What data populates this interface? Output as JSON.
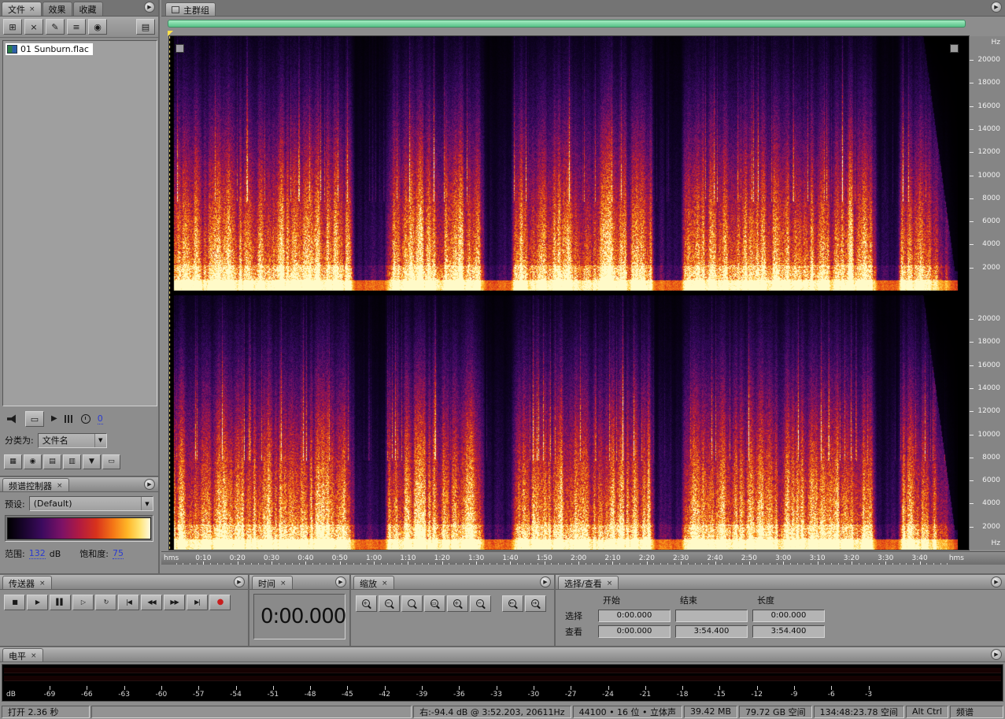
{
  "colors": {
    "accent_green": "#6fcf97",
    "record_red": "#c81e1e",
    "value_blue": "#2a3bd0"
  },
  "ui": {
    "panel_menu_glyph": "▶",
    "dropdown_arrow": "▼"
  },
  "files_panel": {
    "tabs": [
      {
        "label": "文件",
        "close": "×"
      },
      {
        "label": "效果"
      },
      {
        "label": "收藏"
      }
    ],
    "toolbar": [
      {
        "name": "import-file-button",
        "glyph": "⊞"
      },
      {
        "name": "close-file-button",
        "glyph": "×"
      },
      {
        "name": "edit-file-button",
        "glyph": "✎"
      },
      {
        "name": "insert-into-multitrack-button",
        "glyph": "≡"
      },
      {
        "name": "insert-into-cd-button",
        "glyph": "◉"
      }
    ],
    "options_button_glyph": "▤",
    "files": [
      {
        "name": "01 Sunburn.flac"
      }
    ],
    "media_row": {
      "play_glyph": "▶",
      "follow_glyph": "▭",
      "value": "0"
    },
    "sort": {
      "label": "分类为:",
      "value": "文件名"
    },
    "view_toggles": [
      {
        "name": "show-audio-files-toggle",
        "glyph": "▦"
      },
      {
        "name": "show-loop-files-toggle",
        "glyph": "◉"
      },
      {
        "name": "show-video-files-toggle",
        "glyph": "▤"
      },
      {
        "name": "show-session-files-toggle",
        "glyph": "▥"
      },
      {
        "name": "filter-files-toggle",
        "glyph": "▼"
      },
      {
        "name": "show-full-path-toggle",
        "glyph": "▭"
      }
    ]
  },
  "spectral_panel": {
    "title": "频谱控制器",
    "close": "×",
    "preset_label": "预设:",
    "preset_value": "(Default)",
    "range_label": "范围:",
    "range_value": "132",
    "range_unit": "dB",
    "saturation_label": "饱和度:",
    "saturation_value": "75"
  },
  "main": {
    "tab": "主群组",
    "timeline_unit": "hms",
    "time_tick_labels": [
      "0:10",
      "0:20",
      "0:30",
      "0:40",
      "0:50",
      "1:00",
      "1:10",
      "1:20",
      "1:30",
      "1:40",
      "1:50",
      "2:00",
      "2:10",
      "2:20",
      "2:30",
      "2:40",
      "2:50",
      "3:00",
      "3:10",
      "3:20",
      "3:30",
      "3:40"
    ],
    "freq_unit": "Hz",
    "freq_tick_labels": [
      "20000",
      "18000",
      "16000",
      "14000",
      "12000",
      "10000",
      "8000",
      "6000",
      "4000",
      "2000"
    ],
    "view_duration_seconds": 234.4
  },
  "transport": {
    "title": "传送器",
    "close": "×",
    "buttons": [
      {
        "name": "stop-button",
        "glyph": "■"
      },
      {
        "name": "play-button",
        "glyph": "▶"
      },
      {
        "name": "pause-button",
        "glyph": "▌▌"
      },
      {
        "name": "play-from-cursor-button",
        "glyph": "▷"
      },
      {
        "name": "play-looped-button",
        "glyph": "↻"
      },
      {
        "name": "go-to-beginning-button",
        "glyph": "|◀"
      },
      {
        "name": "rewind-button",
        "glyph": "◀◀"
      },
      {
        "name": "fast-forward-button",
        "glyph": "▶▶"
      },
      {
        "name": "go-to-end-button",
        "glyph": "▶|"
      },
      {
        "name": "record-button",
        "glyph": "●"
      }
    ]
  },
  "time_panel": {
    "title": "时间",
    "close": "×",
    "value": "0:00.000"
  },
  "zoom_panel": {
    "title": "缩放",
    "close": "×",
    "buttons": [
      {
        "name": "zoom-in-horizontal-button",
        "sub": "+"
      },
      {
        "name": "zoom-out-horizontal-button",
        "sub": "−"
      },
      {
        "name": "zoom-out-full-button",
        "sub": ""
      },
      {
        "name": "zoom-to-selection-button",
        "sub": "▭"
      },
      {
        "name": "zoom-in-vertical-button",
        "sub": "+"
      },
      {
        "name": "zoom-out-vertical-button",
        "sub": "−"
      },
      {
        "name": "zoom-to-left-of-selection-button",
        "sub": "←"
      },
      {
        "name": "zoom-to-right-of-selection-button",
        "sub": "→"
      }
    ]
  },
  "selection_panel": {
    "title": "选择/查看",
    "close": "×",
    "columns": {
      "start": "开始",
      "end": "结束",
      "length": "长度"
    },
    "rows": [
      {
        "label": "选择",
        "start": "0:00.000",
        "end": "",
        "length": "0:00.000"
      },
      {
        "label": "查看",
        "start": "0:00.000",
        "end": "3:54.400",
        "length": "3:54.400"
      }
    ]
  },
  "levels_panel": {
    "title": "电平",
    "close": "×",
    "unit": "dB",
    "scale": [
      "-69",
      "-66",
      "-63",
      "-60",
      "-57",
      "-54",
      "-51",
      "-48",
      "-45",
      "-42",
      "-39",
      "-36",
      "-33",
      "-30",
      "-27",
      "-24",
      "-21",
      "-18",
      "-15",
      "-12",
      "-9",
      "-6",
      "-3"
    ]
  },
  "status_bar": {
    "open_info": "打开 2.36 秒",
    "cursor_info": "右:-94.4 dB @  3:52.203, 20611Hz",
    "format_info": "44100 • 16 位 • 立体声",
    "file_size": "39.42 MB",
    "disk_space_free": "79.72 GB 空间",
    "disk_time_free": "134:48:23.78 空间",
    "modifier_keys": "Alt Ctrl",
    "view_mode": "频谱"
  }
}
